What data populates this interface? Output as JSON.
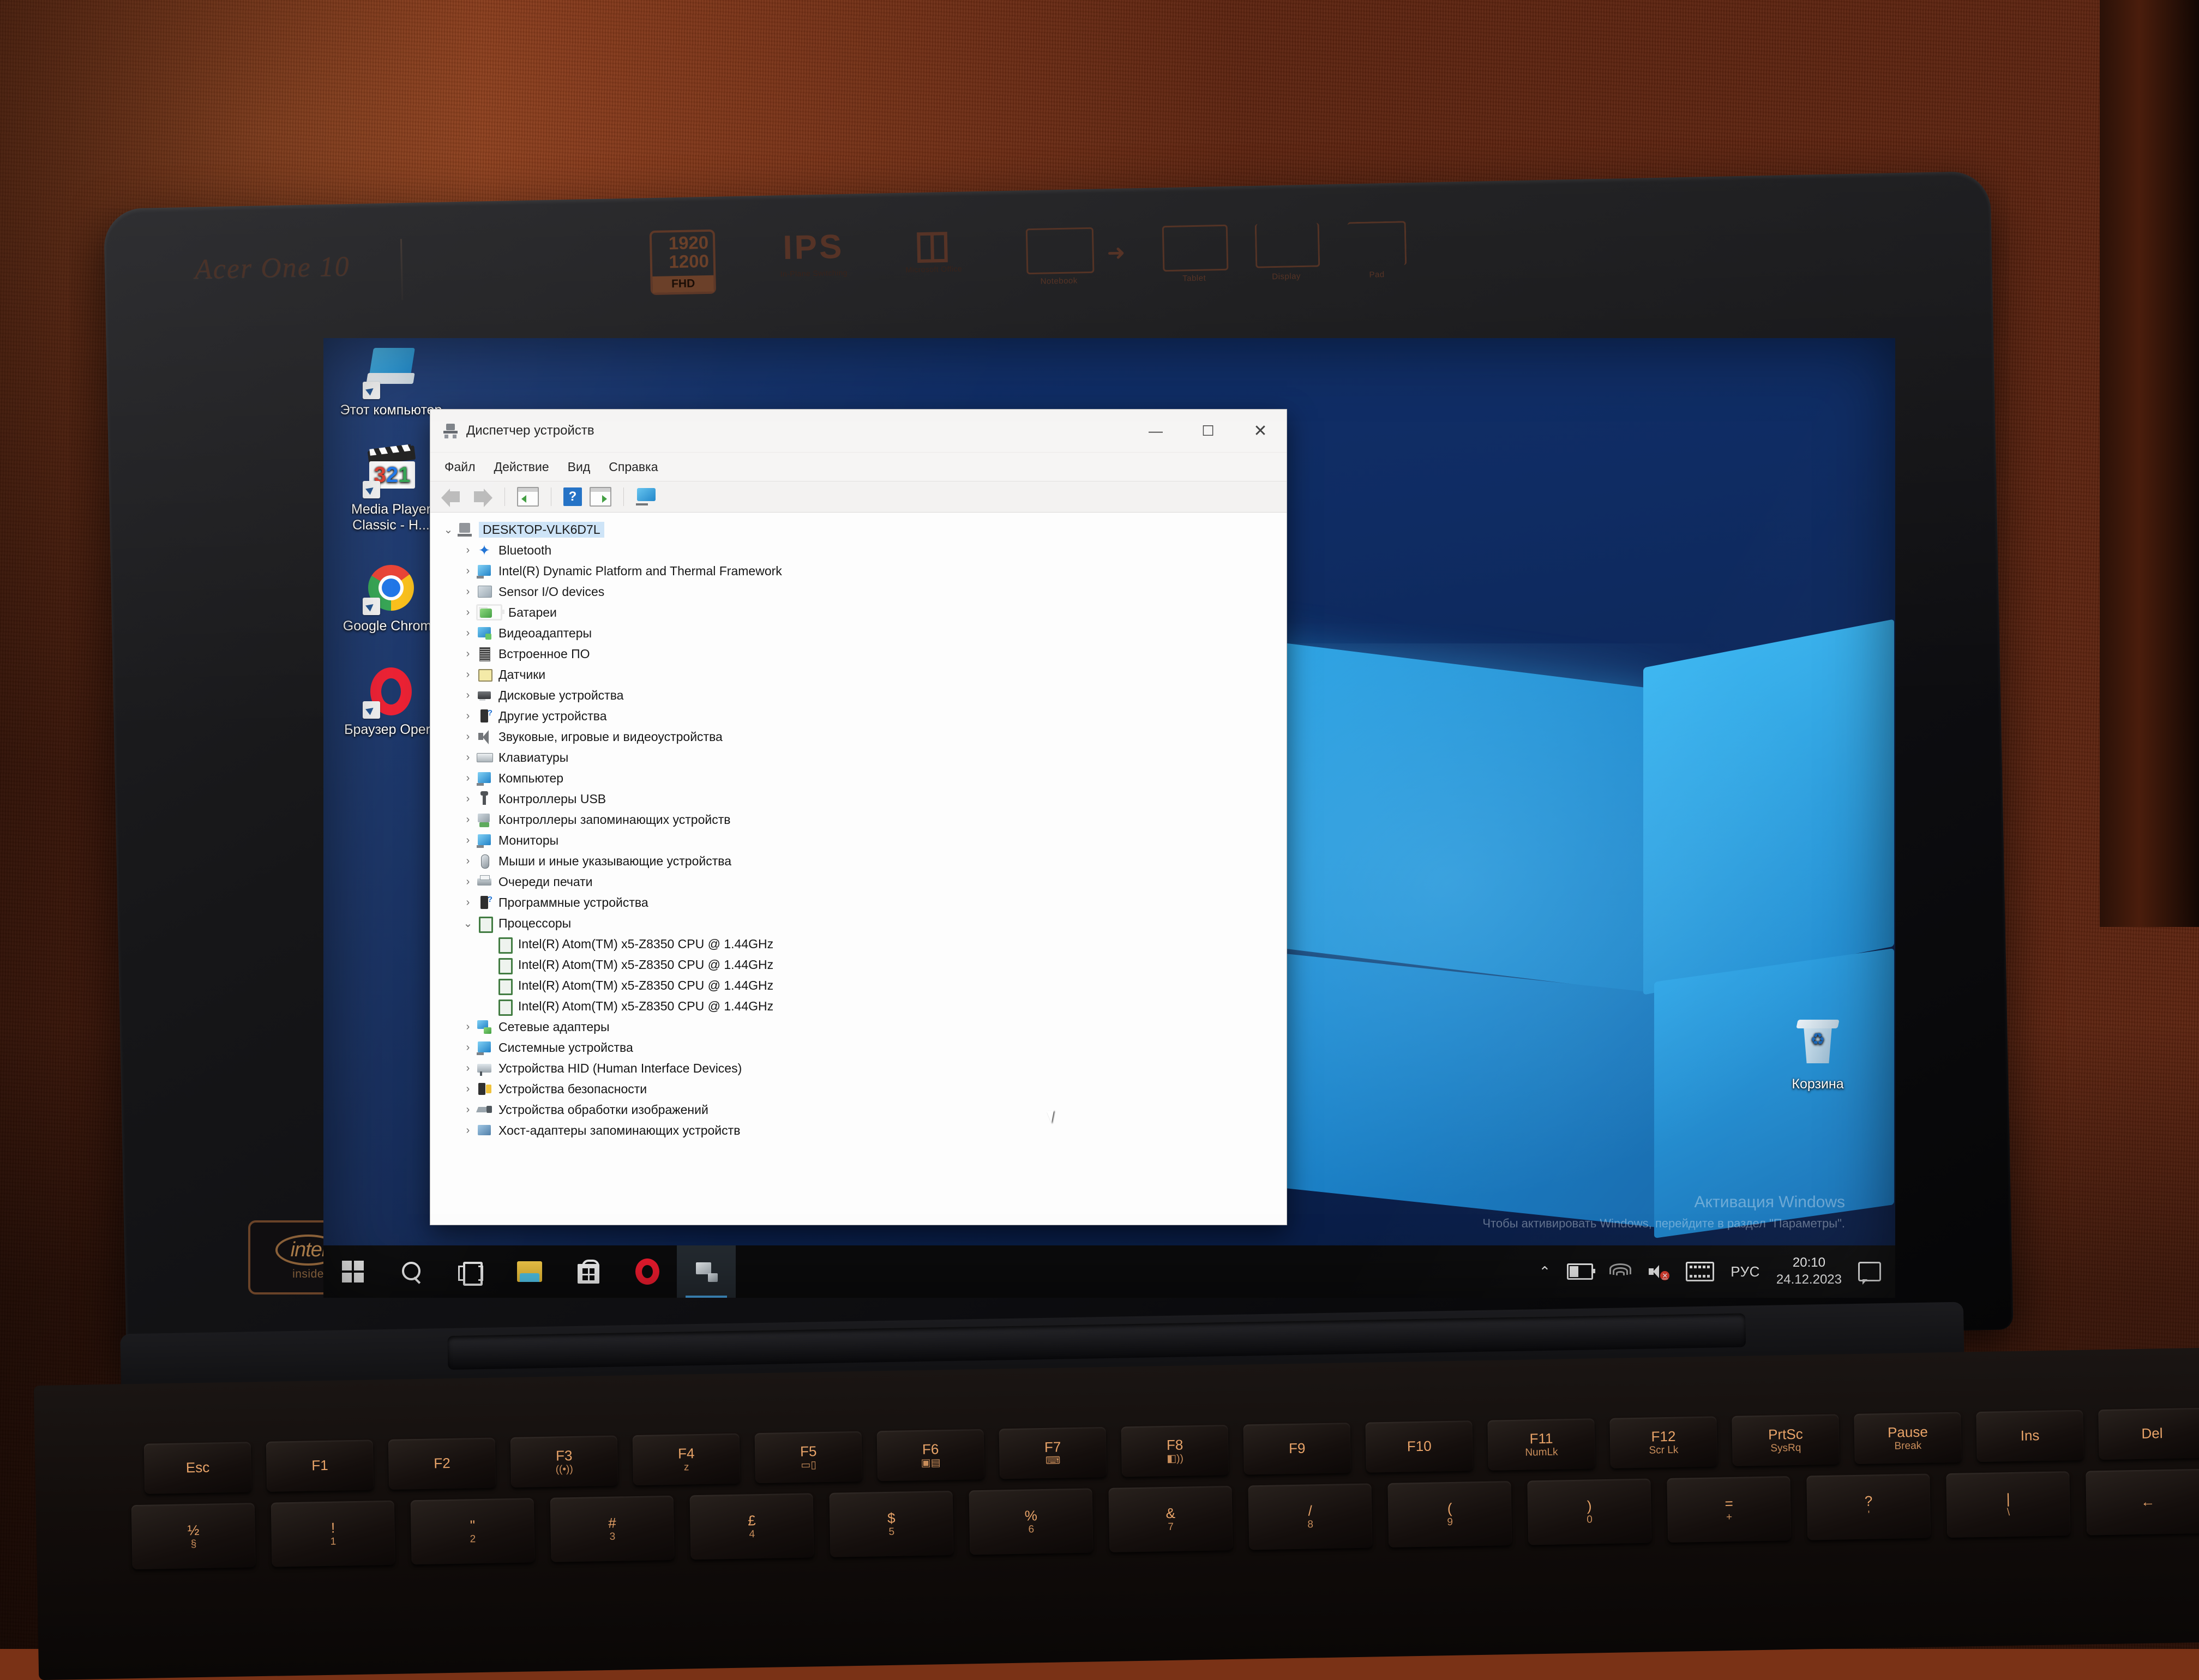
{
  "scene": {
    "laptop_brand": "Acer One 10",
    "bezel_badges": {
      "resolution": "1920×1200",
      "resolution_top": "1920",
      "resolution_bottom": "1200",
      "resolution_tag": "FHD",
      "panel": "IPS",
      "office": "Office",
      "ips_caption": "In-Plane Switching",
      "office_caption": "Microsoft Office",
      "mode_labels": [
        "Notebook",
        "Tablet",
        "Display",
        "Pad"
      ]
    },
    "intel_sticker": {
      "brand": "intel",
      "sub": "inside"
    }
  },
  "desktop": {
    "icons": [
      {
        "name": "Этот компьютер",
        "icon": "this-pc-icon"
      },
      {
        "name": "Media Player Classic - H...",
        "icon": "mpc-icon",
        "badge": "321"
      },
      {
        "name": "Google Chrome",
        "icon": "chrome-icon"
      },
      {
        "name": "Браузер Opera",
        "icon": "opera-icon"
      },
      {
        "name": "Корзина",
        "icon": "recycle-bin-icon"
      }
    ],
    "watermark": {
      "line1": "Активация Windows",
      "line2": "Чтобы активировать Windows, перейдите в раздел \"Параметры\"."
    }
  },
  "window": {
    "title": "Диспетчер устройств",
    "title_icon": "device-manager-icon",
    "controls": {
      "minimize": "—",
      "maximize": "☐",
      "close": "✕"
    },
    "menu": [
      "Файл",
      "Действие",
      "Вид",
      "Справка"
    ],
    "toolbar": [
      "back-arrow-icon",
      "forward-arrow-icon",
      "properties-icon",
      "help-icon",
      "scan-icon",
      "display-devices-icon"
    ]
  },
  "tree": {
    "root": {
      "label": "DESKTOP-VLK6D7L",
      "expanded": true,
      "selected": true,
      "icon": "computer-icon"
    },
    "items": [
      {
        "label": "Bluetooth",
        "icon": "bluetooth-icon",
        "state": "collapsed",
        "indent": 1
      },
      {
        "label": "Intel(R) Dynamic Platform and Thermal Framework",
        "icon": "chipset-icon",
        "state": "collapsed",
        "indent": 1
      },
      {
        "label": "Sensor I/O devices",
        "icon": "sensor-io-icon",
        "state": "collapsed",
        "indent": 1
      },
      {
        "label": "Батареи",
        "icon": "battery-icon",
        "state": "collapsed",
        "indent": 1
      },
      {
        "label": "Видеоадаптеры",
        "icon": "display-adapter-icon",
        "state": "collapsed",
        "indent": 1
      },
      {
        "label": "Встроенное ПО",
        "icon": "firmware-icon",
        "state": "collapsed",
        "indent": 1
      },
      {
        "label": "Датчики",
        "icon": "sensors-icon",
        "state": "collapsed",
        "indent": 1
      },
      {
        "label": "Дисковые устройства",
        "icon": "disk-drive-icon",
        "state": "collapsed",
        "indent": 1
      },
      {
        "label": "Другие устройства",
        "icon": "other-devices-icon",
        "state": "collapsed",
        "indent": 1
      },
      {
        "label": "Звуковые, игровые и видеоустройства",
        "icon": "sound-icon",
        "state": "collapsed",
        "indent": 1
      },
      {
        "label": "Клавиатуры",
        "icon": "keyboard-icon",
        "state": "collapsed",
        "indent": 1
      },
      {
        "label": "Компьютер",
        "icon": "computer-node-icon",
        "state": "collapsed",
        "indent": 1
      },
      {
        "label": "Контроллеры USB",
        "icon": "usb-icon",
        "state": "collapsed",
        "indent": 1
      },
      {
        "label": "Контроллеры запоминающих устройств",
        "icon": "storage-controller-icon",
        "state": "collapsed",
        "indent": 1
      },
      {
        "label": "Мониторы",
        "icon": "monitor-icon",
        "state": "collapsed",
        "indent": 1
      },
      {
        "label": "Мыши и иные указывающие устройства",
        "icon": "mouse-icon",
        "state": "collapsed",
        "indent": 1
      },
      {
        "label": "Очереди печати",
        "icon": "printer-icon",
        "state": "collapsed",
        "indent": 1
      },
      {
        "label": "Программные устройства",
        "icon": "software-device-icon",
        "state": "collapsed",
        "indent": 1
      },
      {
        "label": "Процессоры",
        "icon": "processor-icon",
        "state": "expanded",
        "indent": 1
      },
      {
        "label": "Intel(R) Atom(TM) x5-Z8350  CPU @ 1.44GHz",
        "icon": "cpu-icon",
        "state": "leaf",
        "indent": 2
      },
      {
        "label": "Intel(R) Atom(TM) x5-Z8350  CPU @ 1.44GHz",
        "icon": "cpu-icon",
        "state": "leaf",
        "indent": 2
      },
      {
        "label": "Intel(R) Atom(TM) x5-Z8350  CPU @ 1.44GHz",
        "icon": "cpu-icon",
        "state": "leaf",
        "indent": 2
      },
      {
        "label": "Intel(R) Atom(TM) x5-Z8350  CPU @ 1.44GHz",
        "icon": "cpu-icon",
        "state": "leaf",
        "indent": 2
      },
      {
        "label": "Сетевые адаптеры",
        "icon": "network-adapter-icon",
        "state": "collapsed",
        "indent": 1
      },
      {
        "label": "Системные устройства",
        "icon": "system-device-icon",
        "state": "collapsed",
        "indent": 1
      },
      {
        "label": "Устройства HID (Human Interface Devices)",
        "icon": "hid-icon",
        "state": "collapsed",
        "indent": 1
      },
      {
        "label": "Устройства безопасности",
        "icon": "security-device-icon",
        "state": "collapsed",
        "indent": 1
      },
      {
        "label": "Устройства обработки изображений",
        "icon": "imaging-device-icon",
        "state": "collapsed",
        "indent": 1
      },
      {
        "label": "Хост-адаптеры запоминающих устройств",
        "icon": "storage-host-adapter-icon",
        "state": "collapsed",
        "indent": 1
      }
    ]
  },
  "taskbar": {
    "buttons": [
      {
        "name": "Пуск",
        "icon": "windows-start-icon"
      },
      {
        "name": "Поиск",
        "icon": "search-icon"
      },
      {
        "name": "Представление задач",
        "icon": "task-view-icon"
      },
      {
        "name": "Проводник",
        "icon": "file-explorer-icon"
      },
      {
        "name": "Microsoft Store",
        "icon": "store-icon"
      },
      {
        "name": "Opera",
        "icon": "opera-icon"
      },
      {
        "name": "Диспетчер устройств",
        "icon": "device-manager-icon",
        "active": true
      }
    ],
    "tray": {
      "chevron": "⌃",
      "icons": [
        "battery-icon",
        "wifi-icon",
        "speaker-muted-icon",
        "touch-keyboard-icon"
      ],
      "language": "РУС",
      "time": "20:10",
      "date": "24.12.2023",
      "notification": "action-center-icon"
    }
  },
  "keyboard": {
    "fn_row": [
      {
        "k1": "Esc",
        "k2": ""
      },
      {
        "k1": "F1",
        "k2": ""
      },
      {
        "k1": "F2",
        "k2": ""
      },
      {
        "k1": "F3",
        "k2": "((•))"
      },
      {
        "k1": "F4",
        "k2": "z"
      },
      {
        "k1": "F5",
        "k2": "▭▯"
      },
      {
        "k1": "F6",
        "k2": "▣▤"
      },
      {
        "k1": "F7",
        "k2": "⌨"
      },
      {
        "k1": "F8",
        "k2": "◧))"
      },
      {
        "k1": "F9",
        "k2": ""
      },
      {
        "k1": "F10",
        "k2": ""
      },
      {
        "k1": "F11",
        "k2": "NumLk"
      },
      {
        "k1": "F12",
        "k2": "Scr Lk"
      },
      {
        "k1": "PrtSc",
        "k2": "SysRq"
      },
      {
        "k1": "Pause",
        "k2": "Break"
      },
      {
        "k1": "Ins",
        "k2": ""
      },
      {
        "k1": "Del",
        "k2": ""
      }
    ],
    "num_row": [
      {
        "k1": "½",
        "k2": "§"
      },
      {
        "k1": "!",
        "k2": "1"
      },
      {
        "k1": "\"",
        "k2": "2"
      },
      {
        "k1": "#",
        "k2": "3"
      },
      {
        "k1": "£",
        "k2": "4"
      },
      {
        "k1": "$",
        "k2": "5"
      },
      {
        "k1": "%",
        "k2": "6"
      },
      {
        "k1": "&",
        "k2": "7"
      },
      {
        "k1": "/",
        "k2": "8"
      },
      {
        "k1": "(",
        "k2": "9"
      },
      {
        "k1": ")",
        "k2": "0"
      },
      {
        "k1": "=",
        "k2": "+"
      },
      {
        "k1": "?",
        "k2": "'"
      },
      {
        "k1": "|",
        "k2": "\\"
      },
      {
        "k1": "←",
        "k2": ""
      }
    ]
  }
}
